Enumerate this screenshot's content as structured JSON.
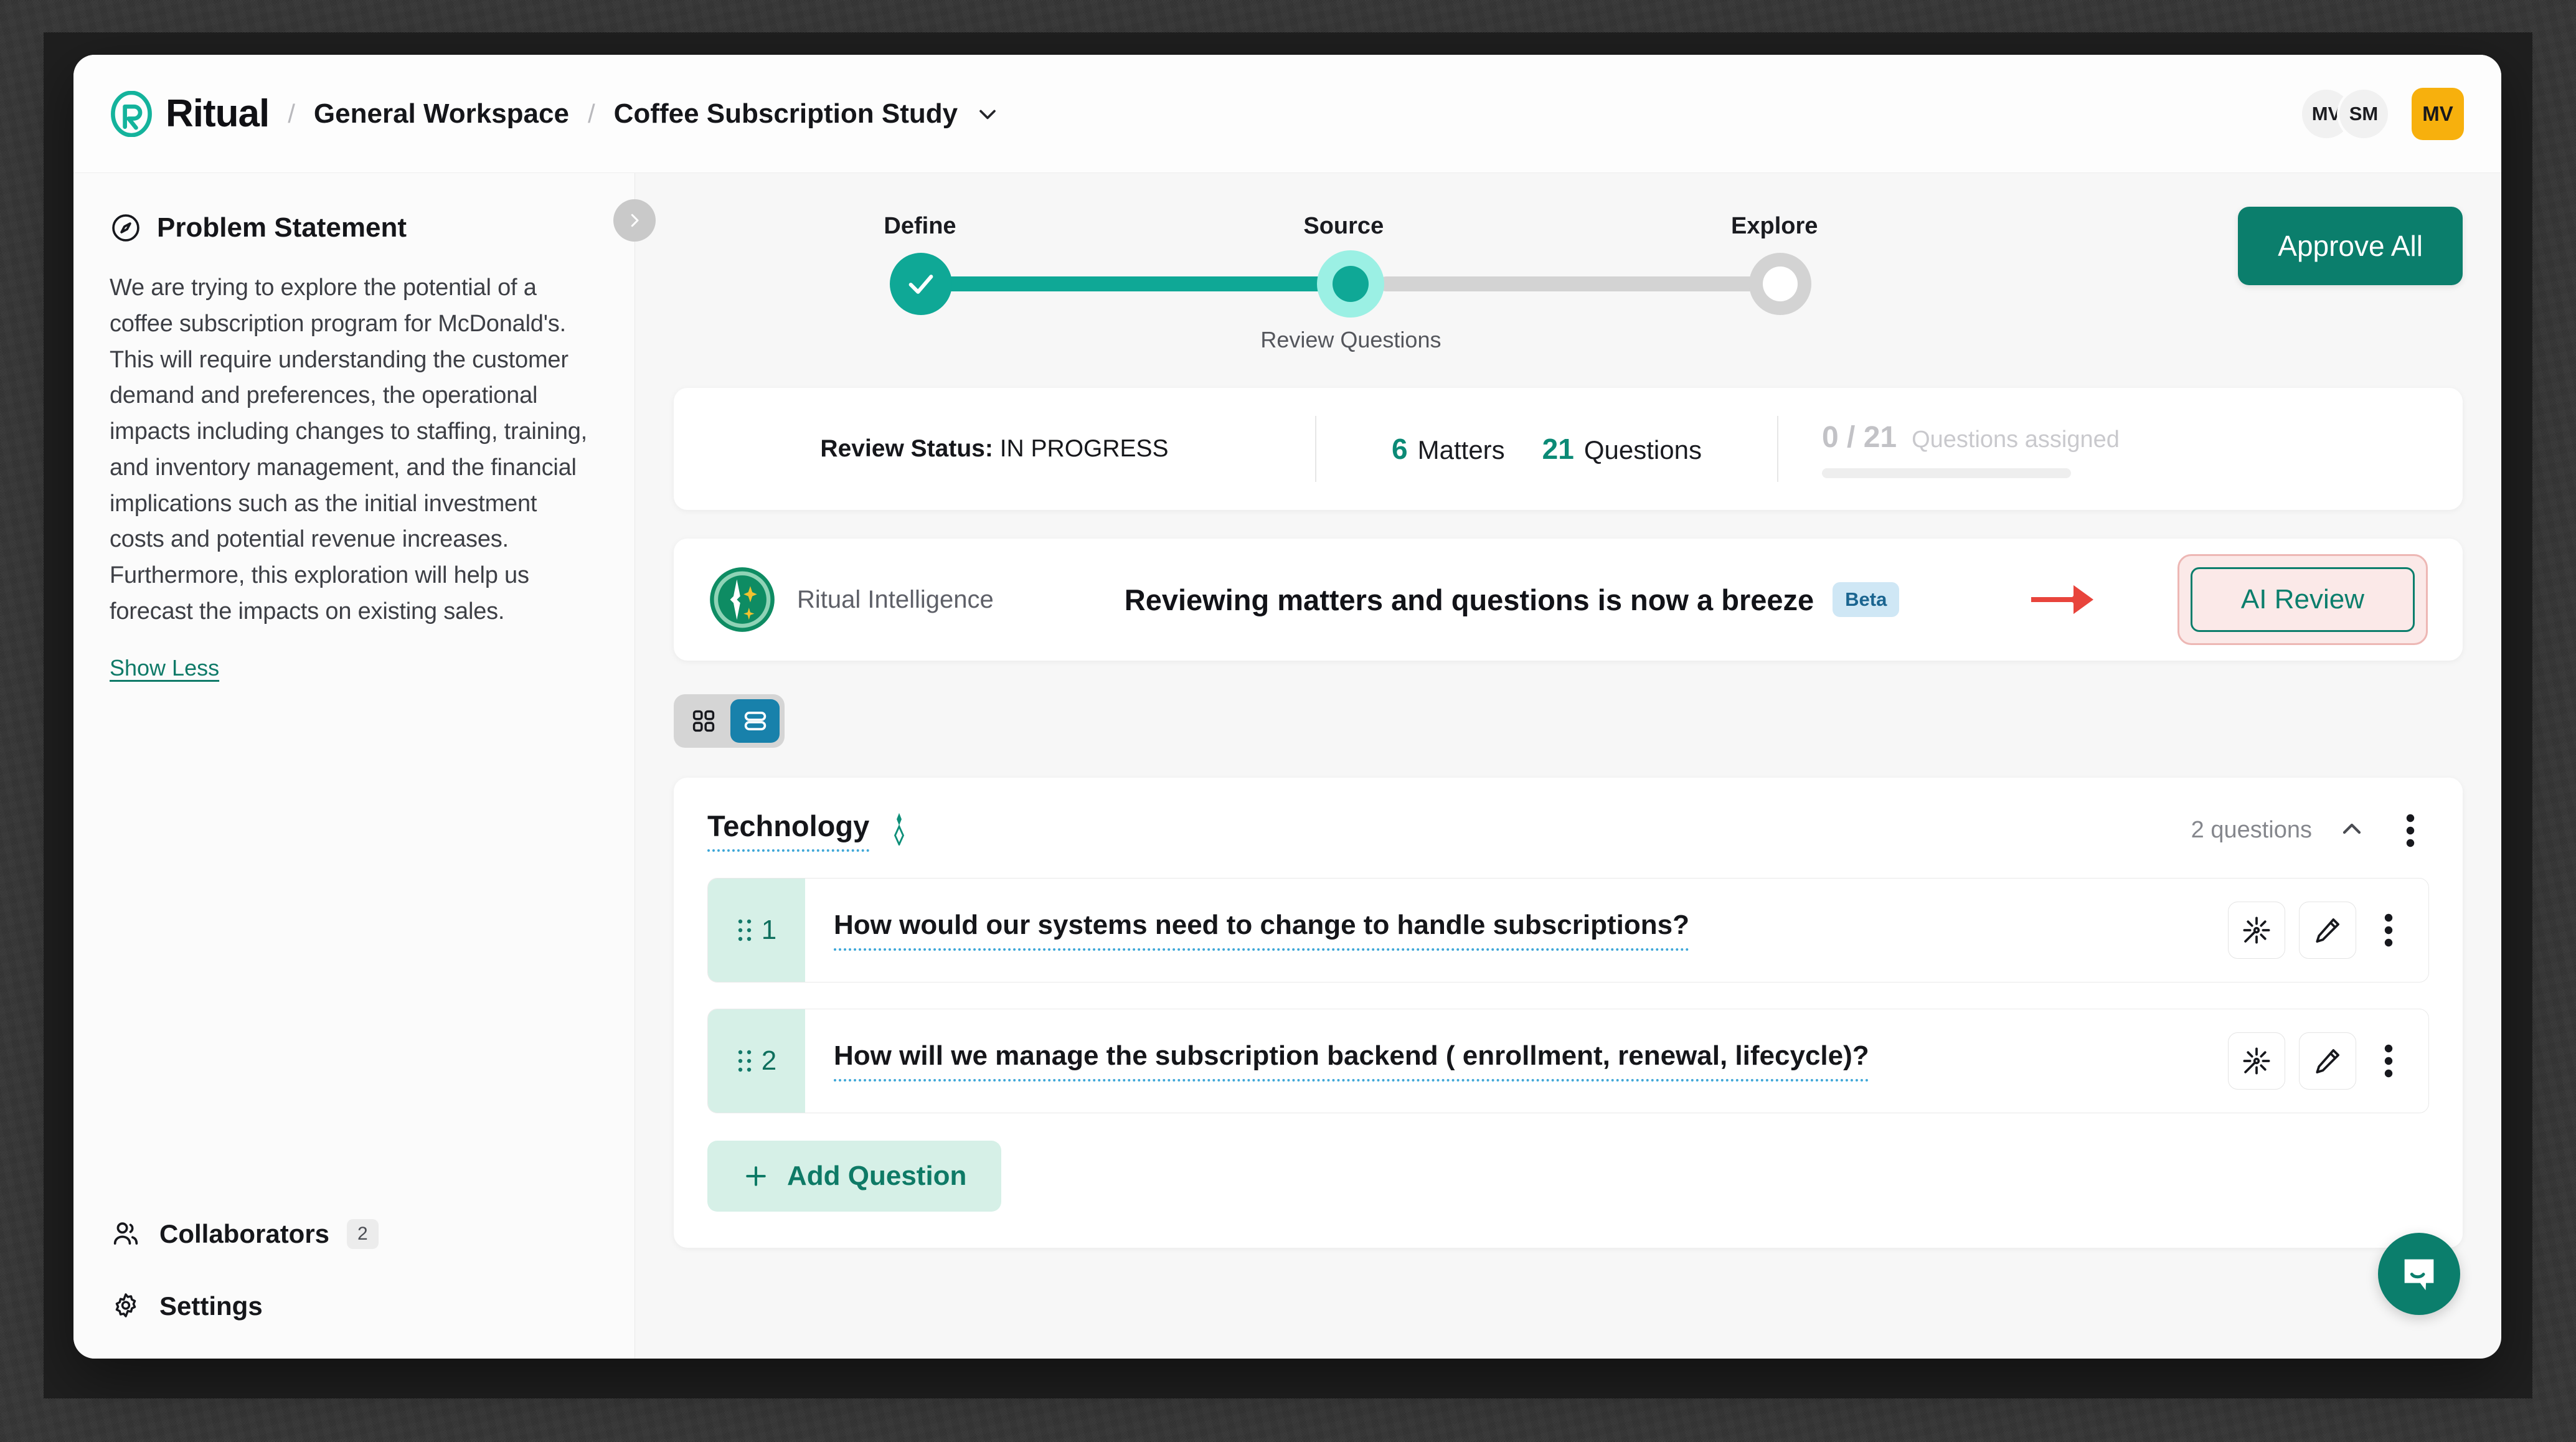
{
  "header": {
    "brand": "Ritual",
    "breadcrumb_sep": "/",
    "workspace": "General Workspace",
    "study": "Coffee Subscription Study",
    "avatars": [
      {
        "initials": "MV",
        "type": "circle"
      },
      {
        "initials": "SM",
        "type": "circle"
      }
    ],
    "user_avatar": {
      "initials": "MV",
      "color": "#f7b00d"
    }
  },
  "sidebar": {
    "panel_title": "Problem Statement",
    "problem_statement": "We are trying to explore the potential of a coffee subscription program for McDonald's. This will require understanding the customer demand and preferences, the operational impacts including changes to staffing, training, and inventory management, and the financial implications such as the initial investment costs and potential revenue increases. Furthermore, this exploration will help us forecast the impacts on existing sales.",
    "show_less": "Show Less",
    "nav": [
      {
        "label": "Collaborators",
        "badge": "2",
        "icon": "users-icon"
      },
      {
        "label": "Settings",
        "badge": "",
        "icon": "gear-icon"
      }
    ]
  },
  "stepper": {
    "steps": [
      {
        "label": "Define",
        "state": "complete"
      },
      {
        "label": "Source",
        "state": "active"
      },
      {
        "label": "Explore",
        "state": "todo"
      }
    ],
    "substep": "Review Questions"
  },
  "actions": {
    "approve_all": "Approve All"
  },
  "status": {
    "review_status_label": "Review Status:",
    "review_status_value": "IN PROGRESS",
    "matters_count": "6",
    "matters_label": "Matters",
    "questions_count": "21",
    "questions_label": "Questions",
    "assigned_value": "0 / 21",
    "assigned_label": "Questions assigned",
    "assigned_progress_pct": 0
  },
  "ai_banner": {
    "brand": "Ritual Intelligence",
    "headline": "Reviewing matters and questions is now a breeze",
    "badge": "Beta",
    "button": "AI Review"
  },
  "view_toggle": {
    "grid_label": "grid-view",
    "list_label": "list-view",
    "active": "list",
    "active_color": "#1881ab"
  },
  "questions_panel": {
    "category": "Technology",
    "count_label": "2 questions",
    "collapse_icon": "chevron-up-icon",
    "menu_icon": "kebab-menu-icon",
    "rows": [
      {
        "number": "1",
        "text": "How would our systems need to change to handle subscriptions?"
      },
      {
        "number": "2",
        "text": "How will we manage the subscription backend ( enrollment, renewal, lifecycle)?"
      }
    ],
    "add_question": "Add Question"
  },
  "colors": {
    "teal": "#0b7e6c",
    "teal_bright": "#0fa896",
    "mint": "#d6f0e7",
    "amber": "#f7b00d",
    "blue": "#1881ab",
    "highlight_pink": "#fbe9e8",
    "arrow_red": "#e8443c"
  }
}
